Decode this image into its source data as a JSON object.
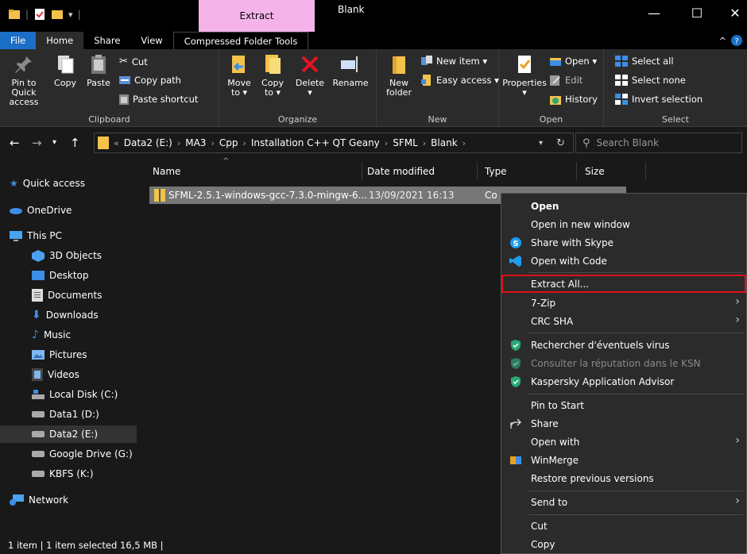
{
  "titlebar": {
    "contextual_tab": "Extract",
    "window_title": "Blank",
    "minimize": "—",
    "maximize": "☐",
    "close": "✕"
  },
  "ribbon_tabs": {
    "file": "File",
    "home": "Home",
    "share": "Share",
    "view": "View",
    "tools": "Compressed Folder Tools"
  },
  "ribbon": {
    "clipboard": {
      "label": "Clipboard",
      "pin": "Pin to Quick",
      "pin2": "access",
      "copy": "Copy",
      "paste": "Paste",
      "cut": "Cut",
      "copy_path": "Copy path",
      "paste_shortcut": "Paste shortcut"
    },
    "organize": {
      "label": "Organize",
      "move": "Move",
      "move2": "to ▾",
      "copy": "Copy",
      "copy2": "to ▾",
      "delete": "Delete",
      "delete2": "▾",
      "rename": "Rename"
    },
    "new": {
      "label": "New",
      "new_item": "New item ▾",
      "easy_access": "Easy access ▾",
      "new_folder": "New",
      "new_folder2": "folder"
    },
    "open": {
      "label": "Open",
      "properties": "Properties",
      "properties2": "▾",
      "open": "Open ▾",
      "edit": "Edit",
      "history": "History"
    },
    "select": {
      "label": "Select",
      "select_all": "Select all",
      "select_none": "Select none",
      "invert": "Invert selection"
    }
  },
  "address": {
    "overflow": "«",
    "crumbs": [
      "Data2 (E:)",
      "MA3",
      "Cpp",
      "Installation C++ QT Geany",
      "SFML",
      "Blank"
    ],
    "search_placeholder": "Search Blank"
  },
  "nav": {
    "items": [
      "Quick access",
      "OneDrive",
      "This PC",
      "3D Objects",
      "Desktop",
      "Documents",
      "Downloads",
      "Music",
      "Pictures",
      "Videos",
      "Local Disk (C:)",
      "Data1 (D:)",
      "Data2 (E:)",
      "Google Drive (G:)",
      "KBFS (K:)",
      "Network"
    ]
  },
  "columns": {
    "name": "Name",
    "date": "Date modified",
    "type": "Type",
    "size": "Size"
  },
  "file": {
    "name": "SFML-2.5.1-windows-gcc-7.3.0-mingw-6...",
    "date": "13/09/2021 16:13",
    "type_partial": "Co"
  },
  "status": {
    "text": "1 item  |  1 item selected  16,5 MB  |"
  },
  "context_menu": {
    "open": "Open",
    "open_new_window": "Open in new window",
    "share_skype": "Share with Skype",
    "open_code": "Open with Code",
    "extract_all": "Extract All...",
    "sevenzip": "7-Zip",
    "crc": "CRC SHA",
    "scan": "Rechercher d'éventuels virus",
    "ksn": "Consulter la réputation dans le KSN",
    "kaspersky": "Kaspersky Application Advisor",
    "pin_start": "Pin to Start",
    "share": "Share",
    "open_with": "Open with",
    "winmerge": "WinMerge",
    "restore": "Restore previous versions",
    "send_to": "Send to",
    "cut": "Cut",
    "copy": "Copy"
  },
  "colors": {
    "accent": "#1b6fc7",
    "extract_tab": "#f4b4e9",
    "highlight_border": "#e0101a",
    "kaspersky_green": "#2aa876"
  }
}
